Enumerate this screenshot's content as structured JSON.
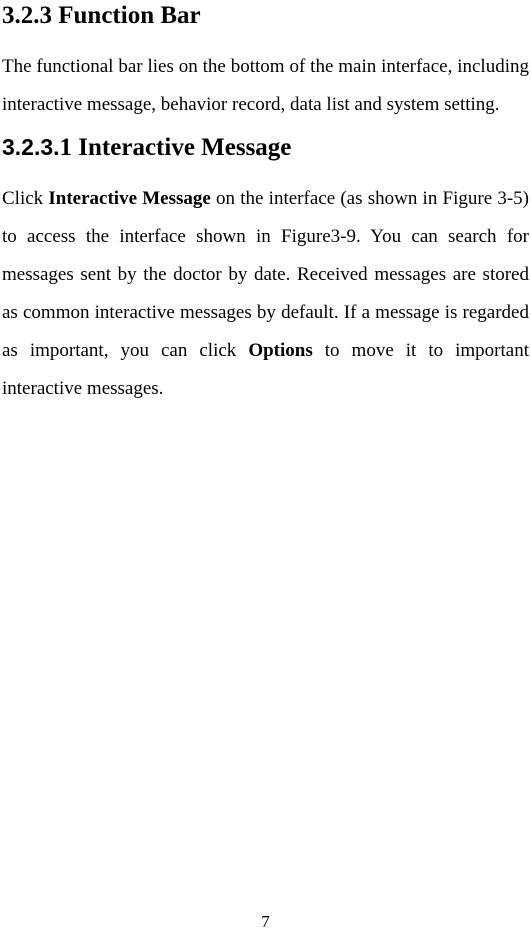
{
  "section1": {
    "heading": "3.2.3 Function Bar",
    "paragraph": "The functional bar lies on the bottom of the main interface, including interactive message, behavior record, data list and system setting."
  },
  "section2": {
    "headingPrefix": "3.2.3.",
    "headingRest": "1 Interactive Message",
    "p1_a": "Click ",
    "p1_bold1": "Interactive Message",
    "p1_b": " on the interface (as shown in Figure 3-5) to access the interface shown in Figure3-9. You can search for messages sent by the doctor by date. Received messages are stored as common interactive messages by default. If a message is regarded as important, you can click ",
    "p1_bold2": "Options",
    "p1_c": " to move it to important interactive messages."
  },
  "pageNumber": "7"
}
